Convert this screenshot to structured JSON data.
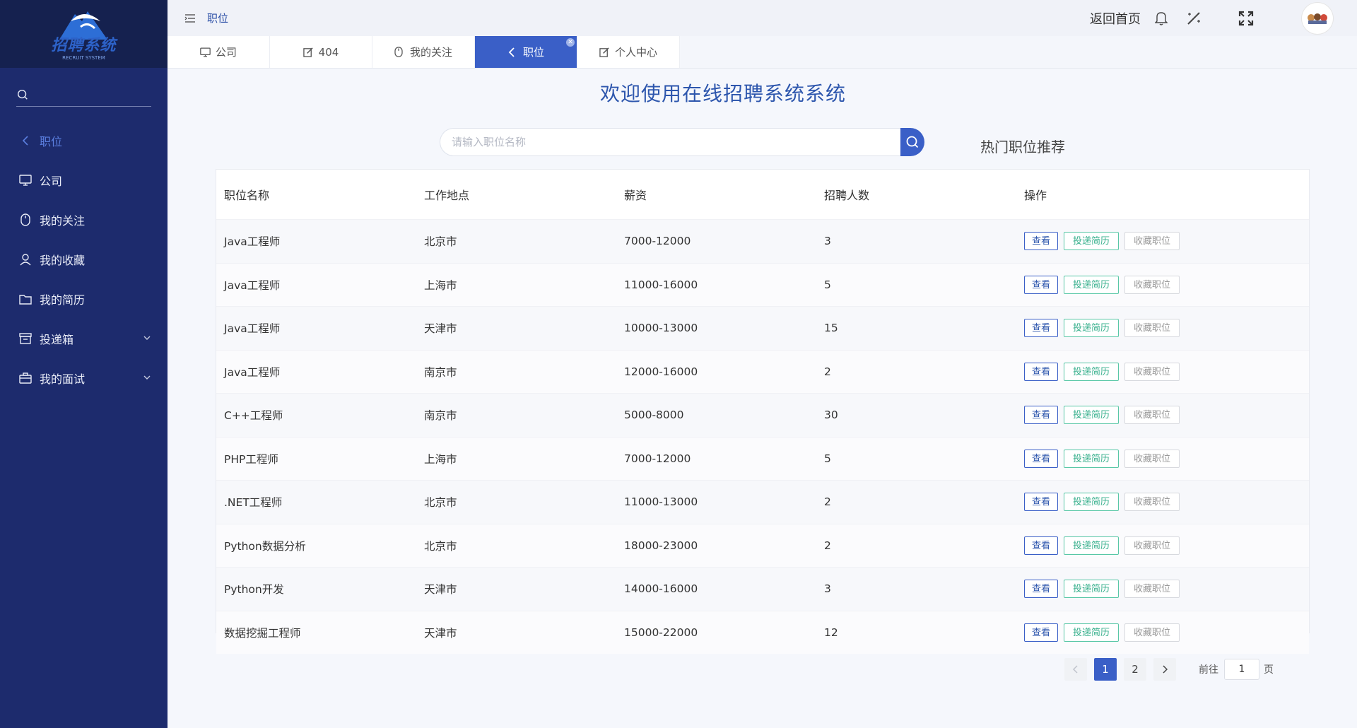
{
  "logo": {
    "text": "招聘系统",
    "subtext": "RECRUIT SYSTEM"
  },
  "sidebar": {
    "items": [
      {
        "label": "职位",
        "icon": "chevron-left-icon",
        "active": true
      },
      {
        "label": "公司",
        "icon": "monitor-icon"
      },
      {
        "label": "我的关注",
        "icon": "mouse-icon"
      },
      {
        "label": "我的收藏",
        "icon": "user-icon"
      },
      {
        "label": "我的简历",
        "icon": "folder-icon"
      },
      {
        "label": "投递箱",
        "icon": "box-icon",
        "expandable": true
      },
      {
        "label": "我的面试",
        "icon": "suitcase-icon",
        "expandable": true
      }
    ]
  },
  "header": {
    "breadcrumb": "职位",
    "home_link": "返回首页"
  },
  "tabs": [
    {
      "label": "公司",
      "icon": "monitor-icon"
    },
    {
      "label": "404",
      "icon": "edit-icon"
    },
    {
      "label": "我的关注",
      "icon": "mouse-icon"
    },
    {
      "label": "职位",
      "icon": "chevron-left-icon",
      "active": true
    },
    {
      "label": "个人中心",
      "icon": "edit-icon"
    }
  ],
  "main": {
    "title": "欢迎使用在线招聘系统系统",
    "search_placeholder": "请输入职位名称",
    "hot_label": "热门职位推荐"
  },
  "table": {
    "headers": [
      "职位名称",
      "工作地点",
      "薪资",
      "招聘人数",
      "操作"
    ],
    "actions": {
      "view": "查看",
      "apply": "投递简历",
      "favorite": "收藏职位"
    },
    "rows": [
      [
        "Java工程师",
        "北京市",
        "7000-12000",
        "3"
      ],
      [
        "Java工程师",
        "上海市",
        "11000-16000",
        "5"
      ],
      [
        "Java工程师",
        "天津市",
        "10000-13000",
        "15"
      ],
      [
        "Java工程师",
        "南京市",
        "12000-16000",
        "2"
      ],
      [
        "C++工程师",
        "南京市",
        "5000-8000",
        "30"
      ],
      [
        "PHP工程师",
        "上海市",
        "7000-12000",
        "5"
      ],
      [
        ".NET工程师",
        "北京市",
        "11000-13000",
        "2"
      ],
      [
        "Python数据分析",
        "北京市",
        "18000-23000",
        "2"
      ],
      [
        "Python开发",
        "天津市",
        "14000-16000",
        "3"
      ],
      [
        "数据挖掘工程师",
        "天津市",
        "15000-22000",
        "12"
      ]
    ]
  },
  "pagination": {
    "pages": [
      "1",
      "2"
    ],
    "current": "1",
    "jump_label": "前往",
    "jump_value": "1",
    "jump_unit": "页"
  },
  "colors": {
    "sidebar": "#1d2b6d",
    "accent": "#3a5fc7",
    "apply": "#38b08d"
  }
}
